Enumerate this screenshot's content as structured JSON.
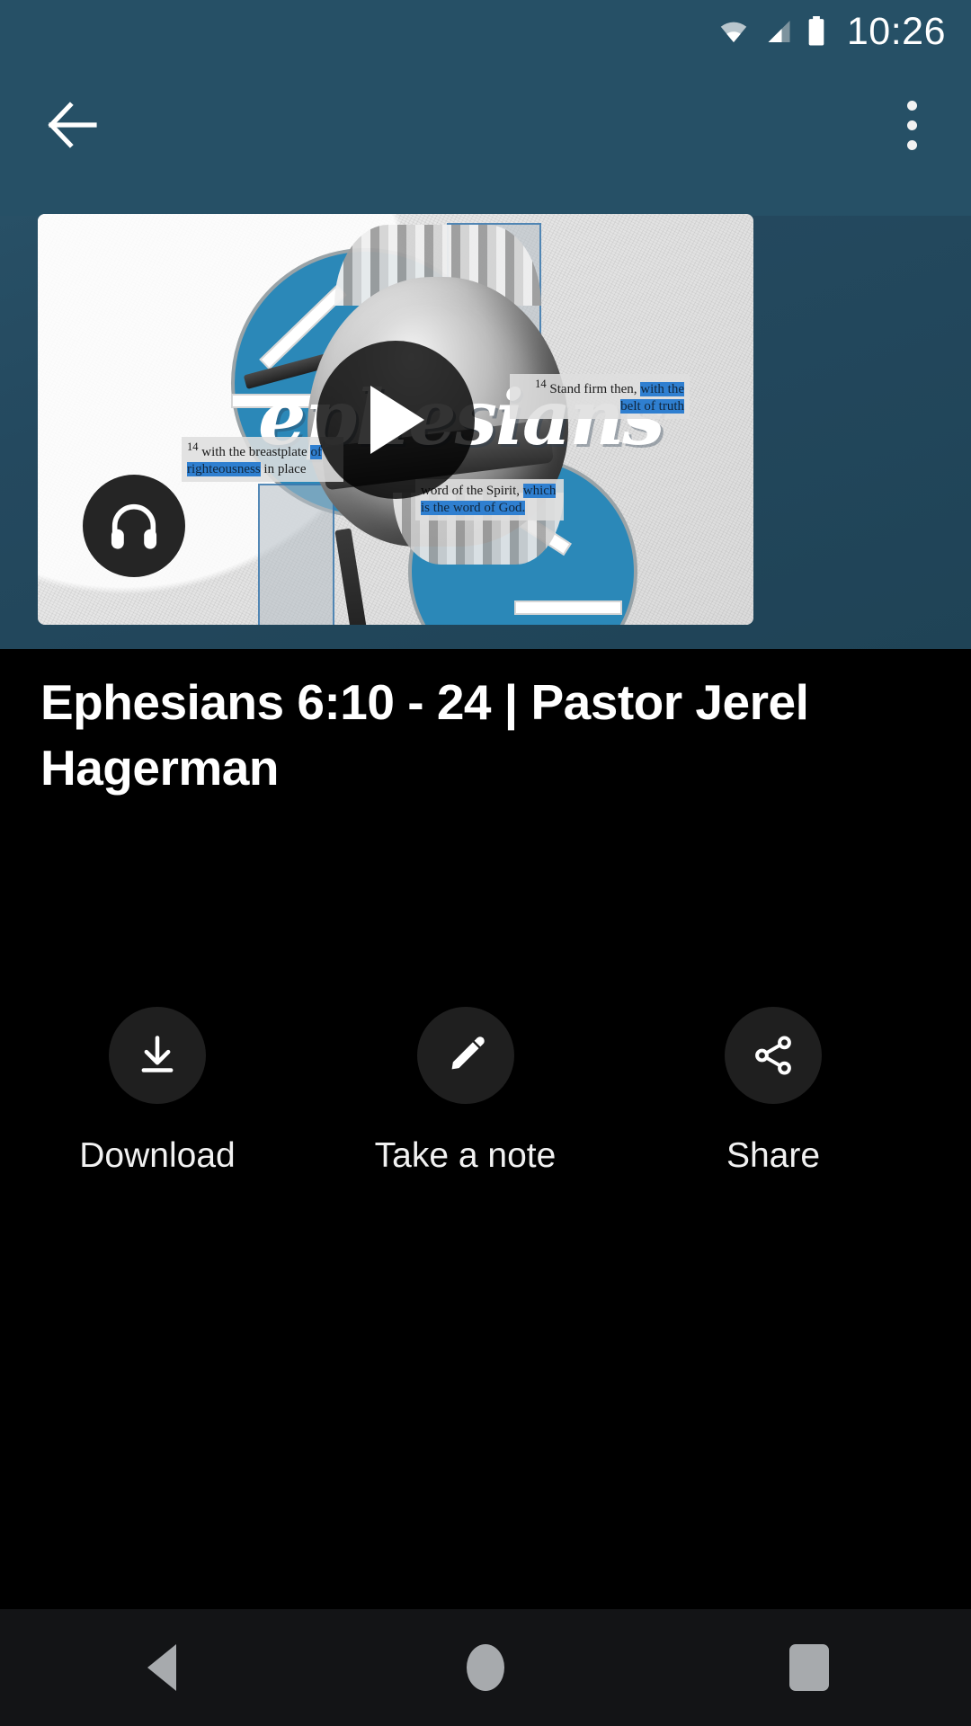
{
  "status_bar": {
    "time": "10:26",
    "icons": [
      "wifi-icon",
      "cellular-signal-icon",
      "battery-icon"
    ]
  },
  "app_bar": {
    "back_label": "Back",
    "overflow_label": "More options"
  },
  "media": {
    "thumbnail": {
      "series_title": "ephesians",
      "verse_fragments": [
        {
          "marker": "14",
          "plain_before": "with the breastplate",
          "highlighted": "of righteousness",
          "plain_after": "in place"
        },
        {
          "marker": "14",
          "plain_before": "Stand firm then,",
          "highlighted": "with the belt of truth",
          "plain_after": ""
        },
        {
          "marker": "",
          "plain_before": "word of the Spirit,",
          "highlighted": "which is the word of God.",
          "plain_after": ""
        }
      ],
      "play_button_label": "Play",
      "audio_button_label": "Listen to audio"
    },
    "title": "Ephesians 6:10 - 24 | Pastor Jerel Hagerman"
  },
  "actions": [
    {
      "id": "download",
      "icon": "download-icon",
      "label": "Download"
    },
    {
      "id": "take-a-note",
      "icon": "pencil-icon",
      "label": "Take a note"
    },
    {
      "id": "share",
      "icon": "share-icon",
      "label": "Share"
    }
  ],
  "nav_bar": {
    "back_label": "Back",
    "home_label": "Home",
    "recents_label": "Recent apps"
  },
  "colors": {
    "app_bar": "#265066",
    "background": "#000000",
    "accent_blue": "#2b88b8",
    "action_circle": "#1f1f1f",
    "nav_bar": "#131416"
  }
}
